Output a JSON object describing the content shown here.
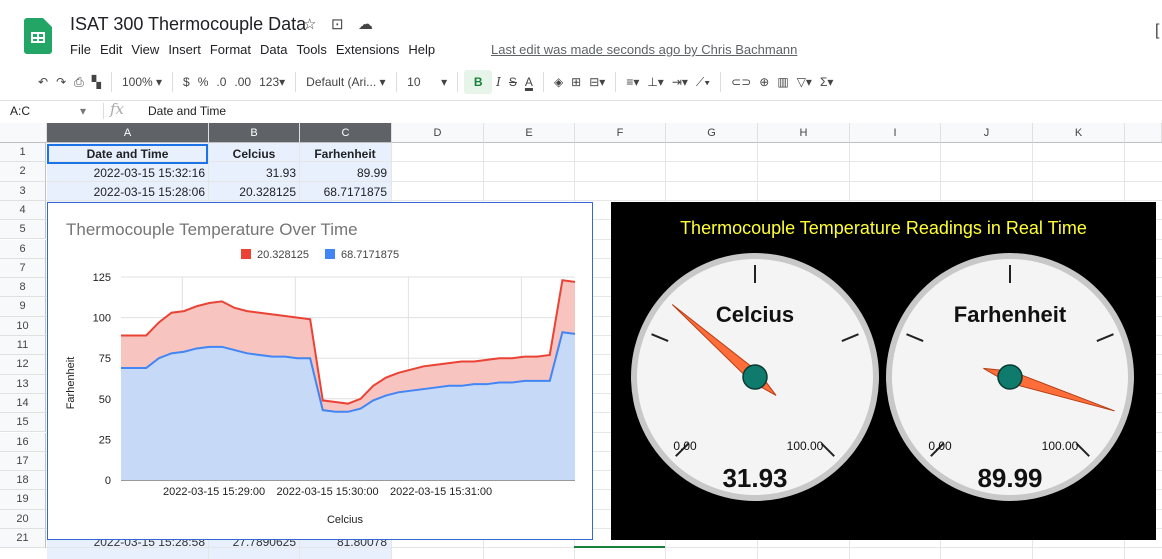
{
  "doc": {
    "title": "ISAT 300 Thermocouple Data",
    "star_icon": "star-icon",
    "move_icon": "folder-move-icon",
    "cloud_icon": "cloud-status-icon",
    "menu": [
      "File",
      "Edit",
      "View",
      "Insert",
      "Format",
      "Data",
      "Tools",
      "Extensions",
      "Help"
    ],
    "last_edit": "Last edit was made seconds ago by Chris Bachmann",
    "right_edge": "["
  },
  "toolbar": {
    "zoom": "100%",
    "currency": "$",
    "percent": "%",
    "dec_decrease": ".0",
    "dec_increase": ".00",
    "format_123": "123",
    "font": "Default (Ari...",
    "font_size": "10",
    "bold": "B",
    "italic": "I",
    "strike": "S",
    "text_color": "A"
  },
  "formula_bar": {
    "name_box": "A:C",
    "fx": "fx",
    "value": "Date and Time"
  },
  "grid": {
    "columns": [
      "A",
      "B",
      "C",
      "D",
      "E",
      "F",
      "G",
      "H",
      "I",
      "J",
      "K"
    ],
    "rows": [
      "1",
      "2",
      "3",
      "4",
      "5",
      "6",
      "7",
      "8",
      "9",
      "10",
      "11",
      "12",
      "13",
      "14",
      "15",
      "16",
      "17",
      "18",
      "19",
      "20",
      "21"
    ],
    "header": [
      "Date and Time",
      "Celcius",
      "Farhenheit"
    ],
    "row2": [
      "2022-03-15 15:32:16",
      "31.93",
      "89.99"
    ],
    "row3": [
      "2022-03-15 15:28:06",
      "20.328125",
      "68.7171875"
    ],
    "row21": [
      "2022-03-15 15:28:58",
      "27.7890625",
      "81.80078"
    ]
  },
  "chart_data": {
    "type": "area",
    "title": "Thermocouple Temperature Over Time",
    "xlabel": "Celcius",
    "ylabel": "Farhenheit",
    "ylim": [
      0,
      125
    ],
    "yticks": [
      "0",
      "25",
      "50",
      "75",
      "100",
      "125"
    ],
    "xticks": [
      "2022-03-15 15:29:00",
      "2022-03-15 15:30:00",
      "2022-03-15 15:31:00"
    ],
    "legend_position": "top",
    "series": [
      {
        "name": "20.328125",
        "color": "#ea4335",
        "values": [
          89,
          89,
          89,
          97,
          103,
          104,
          107,
          109,
          110,
          106,
          104,
          103,
          102,
          101,
          100,
          99,
          49,
          48,
          47,
          50,
          58,
          63,
          66,
          68,
          70,
          71,
          72,
          73,
          73,
          74,
          75,
          75,
          76,
          76,
          77,
          123,
          122
        ]
      },
      {
        "name": "68.7171875",
        "color": "#4285f4",
        "values": [
          69,
          69,
          69,
          75,
          78,
          79,
          81,
          82,
          82,
          80,
          78,
          77,
          76,
          76,
          75,
          75,
          43,
          42,
          42,
          44,
          49,
          52,
          54,
          55,
          56,
          57,
          58,
          58,
          59,
          59,
          60,
          60,
          61,
          61,
          61,
          91,
          90
        ]
      }
    ]
  },
  "gauges": {
    "title": "Thermocouple Temperature Readings in Real Time",
    "min_label": "0.00",
    "max_label": "100.00",
    "items": [
      {
        "label": "Celcius",
        "value": 31.93,
        "display": "31.93"
      },
      {
        "label": "Farhenheit",
        "value": 89.99,
        "display": "89.99"
      }
    ],
    "title_color": "#ffff33",
    "needle_color": "#ff6d3a",
    "hub_color": "#0f7b6c"
  }
}
